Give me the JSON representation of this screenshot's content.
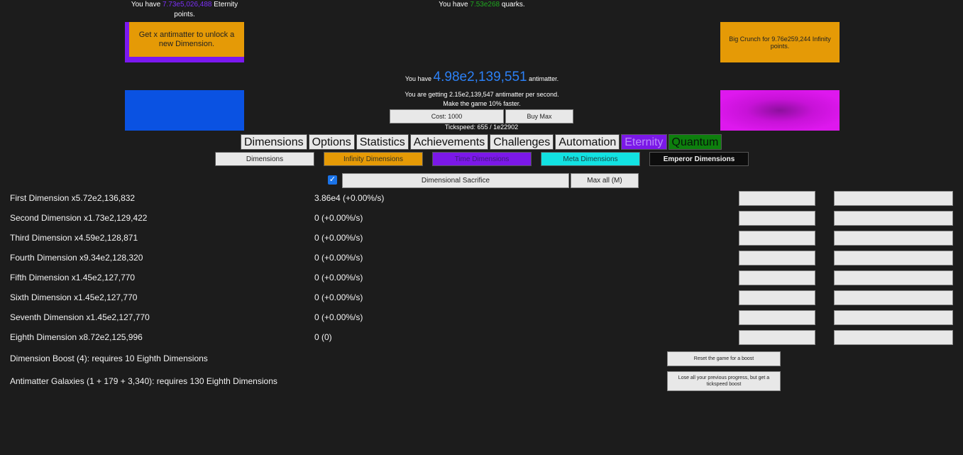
{
  "header": {
    "eternity_prefix": "You have ",
    "eternity_value": "7.73e5,026,488",
    "eternity_suffix": " Eternity",
    "eternity_suffix2": "points.",
    "quarks_prefix": "You have ",
    "quarks_value": "7.53e268",
    "quarks_suffix": " quarks."
  },
  "unlock_button_label": "Get x antimatter to unlock a new Dimension.",
  "crunch_button_label": "Big Crunch for 9.76e259,244 Infinity points.",
  "antimatter": {
    "prefix": "You have ",
    "value": "4.98e2,139,551",
    "suffix": " antimatter.",
    "rate_line": "You are getting 2.15e2,139,547 antimatter per second.",
    "faster_line": "Make the game 10% faster."
  },
  "tickspeed": {
    "cost_label": "Cost: 1000",
    "buy_max_label": "Buy Max",
    "readout": "Tickspeed: 655 / 1e22902"
  },
  "main_tabs": [
    "Dimensions",
    "Options",
    "Statistics",
    "Achievements",
    "Challenges",
    "Automation",
    "Eternity",
    "Quantum"
  ],
  "sub_tabs": [
    "Dimensions",
    "Infinity Dimensions",
    "Time Dimensions",
    "Meta Dimensions",
    "Emperor Dimensions"
  ],
  "sacrifice": {
    "checkbox_glyph": "✓",
    "button_label": "Dimensional Sacrifice",
    "max_all_label": "Max all (M)"
  },
  "dimensions": [
    {
      "name": "First Dimension x5.72e2,136,832",
      "amount": "3.86e4 (+0.00%/s)"
    },
    {
      "name": "Second Dimension x1.73e2,129,422",
      "amount": "0 (+0.00%/s)"
    },
    {
      "name": "Third Dimension x4.59e2,128,871",
      "amount": "0 (+0.00%/s)"
    },
    {
      "name": "Fourth Dimension x9.34e2,128,320",
      "amount": "0 (+0.00%/s)"
    },
    {
      "name": "Fifth Dimension x1.45e2,127,770",
      "amount": "0 (+0.00%/s)"
    },
    {
      "name": "Sixth Dimension x1.45e2,127,770",
      "amount": "0 (+0.00%/s)"
    },
    {
      "name": "Seventh Dimension x1.45e2,127,770",
      "amount": "0 (+0.00%/s)"
    },
    {
      "name": "Eighth Dimension x8.72e2,125,996",
      "amount": "0 (0)"
    }
  ],
  "boost": {
    "label": "Dimension Boost (4): requires 10 Eighth Dimensions",
    "button_label": "Reset the game for a boost"
  },
  "galaxy": {
    "label": "Antimatter Galaxies (1 + 179 + 3,340): requires 130 Eighth Dimensions",
    "button_label": "Lose all your previous progress, but get a tickspeed boost"
  }
}
